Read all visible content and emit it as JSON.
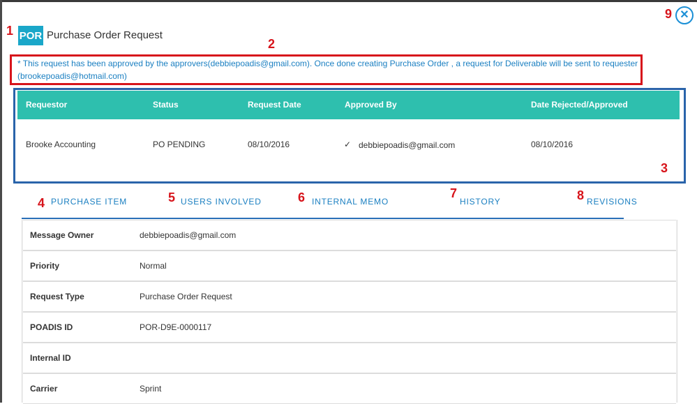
{
  "header": {
    "logo_text": "POR",
    "title": "Purchase Order Request"
  },
  "notice": {
    "text": "* This request has been approved by the approvers(debbiepoadis@gmail.com). Once done creating Purchase Order , a request for Deliverable will be sent to requester (brookepoadis@hotmail.com)"
  },
  "status_table": {
    "columns": [
      "Requestor",
      "Status",
      "Request Date",
      "Approved By",
      "Date Rejected/Approved"
    ],
    "row": {
      "requestor": "Brooke Accounting",
      "status": "PO PENDING",
      "request_date": "08/10/2016",
      "approved_by": "debbiepoadis@gmail.com",
      "date_rejected_approved": "08/10/2016"
    }
  },
  "tabs": [
    "PURCHASE ITEM",
    "USERS INVOLVED",
    "INTERNAL MEMO",
    "HISTORY",
    "REVISIONS"
  ],
  "details": [
    {
      "label": "Message Owner",
      "value": "debbiepoadis@gmail.com"
    },
    {
      "label": "Priority",
      "value": "Normal"
    },
    {
      "label": "Request Type",
      "value": "Purchase Order Request"
    },
    {
      "label": "POADIS ID",
      "value": "POR-D9E-0000117"
    },
    {
      "label": "Internal ID",
      "value": ""
    },
    {
      "label": "Carrier",
      "value": "Sprint"
    }
  ],
  "annotations": [
    "1",
    "2",
    "3",
    "4",
    "5",
    "6",
    "7",
    "8",
    "9"
  ],
  "icons": {
    "close": "close-circle-icon",
    "approved": "check-icon"
  },
  "colors": {
    "accent_teal": "#2ebfae",
    "logo_blue": "#1aa7c9",
    "link_blue": "#1a7fc1",
    "annotation_red": "#d7141b",
    "frame_blue": "#2a64aa"
  }
}
